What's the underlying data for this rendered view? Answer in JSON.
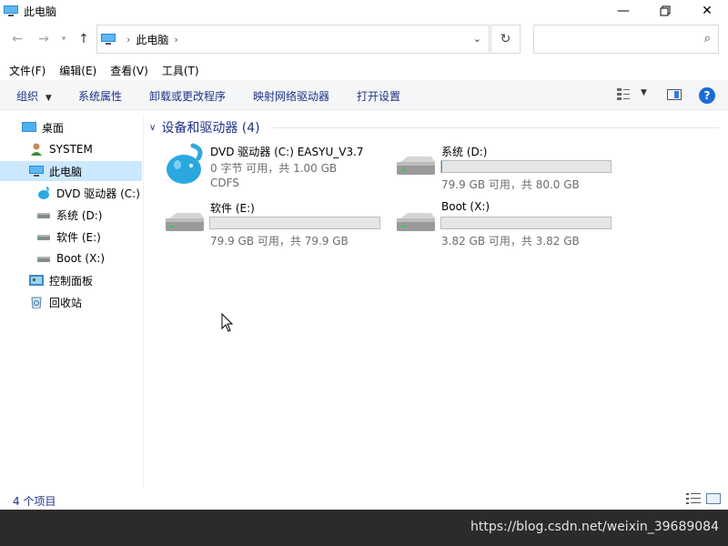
{
  "window": {
    "title": "此电脑",
    "controls": {
      "minimize_icon": "minimize-icon",
      "maximize_icon": "maximize-icon",
      "close_icon": "close-icon"
    }
  },
  "navigation": {
    "back_icon": "arrow-left-icon",
    "forward_icon": "arrow-right-icon",
    "recent_icon": "chevron-down-icon",
    "up_icon": "arrow-up-icon"
  },
  "address": {
    "crumbs": [
      "此电脑"
    ],
    "refresh_icon": "refresh-icon",
    "search_placeholder": "",
    "search_icon": "search-icon"
  },
  "menubar": {
    "items": [
      "文件(F)",
      "编辑(E)",
      "查看(V)",
      "工具(T)"
    ]
  },
  "commandbar": {
    "organize": "组织",
    "properties": "系统属性",
    "uninstall": "卸载或更改程序",
    "map_drive": "映射网络驱动器",
    "open_settings": "打开设置"
  },
  "sidebar": {
    "items": [
      {
        "label": "桌面",
        "icon": "desktop-icon"
      },
      {
        "label": "SYSTEM",
        "icon": "user-icon"
      },
      {
        "label": "此电脑",
        "icon": "computer-icon",
        "selected": true
      },
      {
        "label": "DVD 驱动器 (C:) E",
        "icon": "dvd-drive-icon"
      },
      {
        "label": "系统 (D:)",
        "icon": "hard-drive-icon"
      },
      {
        "label": "软件 (E:)",
        "icon": "hard-drive-icon"
      },
      {
        "label": "Boot (X:)",
        "icon": "hard-drive-icon"
      },
      {
        "label": "控制面板",
        "icon": "control-panel-icon"
      },
      {
        "label": "回收站",
        "icon": "recycle-bin-icon"
      }
    ]
  },
  "main": {
    "group_title": "设备和驱动器 (4)",
    "drives": [
      {
        "name": "DVD 驱动器 (C:) EASYU_V3.7",
        "detail": "0 字节 可用，共 1.00 GB",
        "filesystem": "CDFS",
        "icon": "dvd-drive-icon",
        "has_bar": false
      },
      {
        "name": "系统 (D:)",
        "detail": "79.9 GB 可用，共 80.0 GB",
        "icon": "hard-drive-icon",
        "has_bar": true,
        "used_fraction": 0.001
      },
      {
        "name": "软件 (E:)",
        "detail": "79.9 GB 可用，共 79.9 GB",
        "icon": "hard-drive-icon",
        "has_bar": true,
        "used_fraction": 0.0
      },
      {
        "name": "Boot (X:)",
        "detail": "3.82 GB 可用，共 3.82 GB",
        "icon": "hard-drive-icon",
        "has_bar": true,
        "used_fraction": 0.0
      }
    ]
  },
  "status": {
    "item_count": "4 个项目"
  },
  "watermark": "https://blog.csdn.net/weixin_39689084",
  "colors": {
    "accent": "#1e3287",
    "selection": "#cce8ff",
    "bar_track": "#e6e6e6",
    "taskbar": "#2b2b2b"
  }
}
